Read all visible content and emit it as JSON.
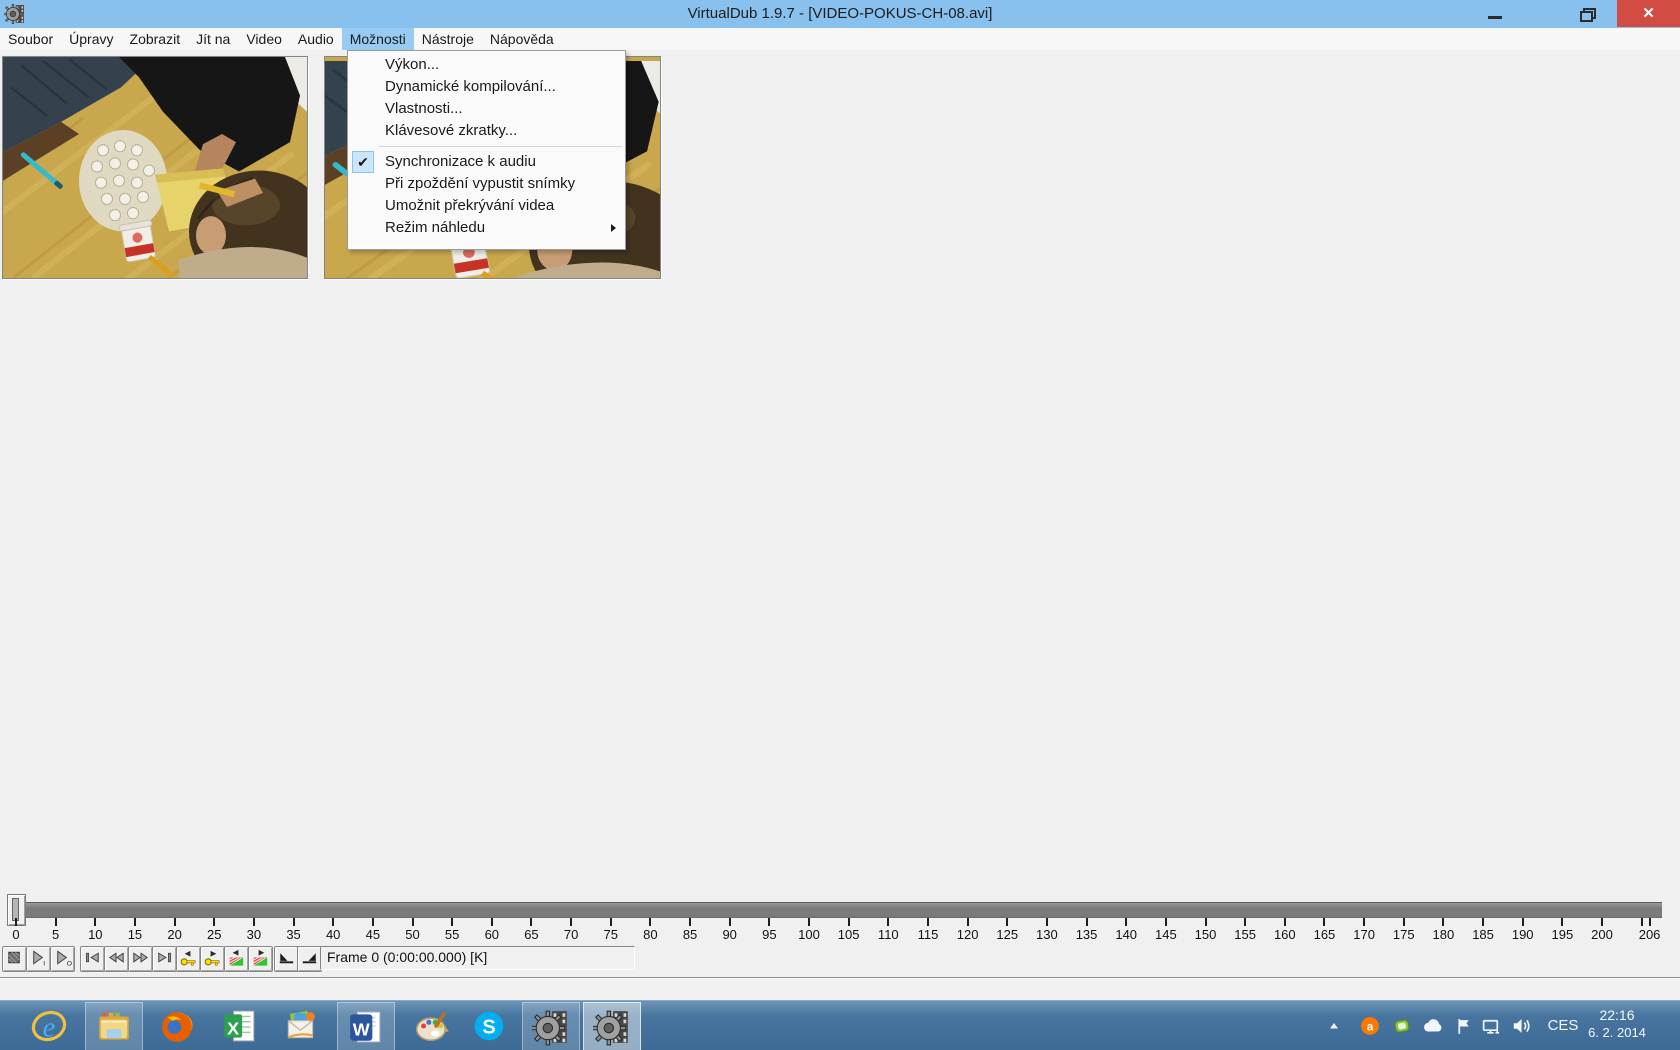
{
  "window": {
    "title": "VirtualDub 1.9.7 - [VIDEO-POKUS-CH-08.avi]"
  },
  "menubar": {
    "items": [
      "Soubor",
      "Úpravy",
      "Zobrazit",
      "Jít na",
      "Video",
      "Audio",
      "Možnosti",
      "Nástroje",
      "Nápověda"
    ],
    "active_index": 6
  },
  "options_menu": {
    "items": [
      {
        "type": "item",
        "label": "Výkon..."
      },
      {
        "type": "item",
        "label": "Dynamické kompilování..."
      },
      {
        "type": "item",
        "label": "Vlastnosti..."
      },
      {
        "type": "item",
        "label": "Klávesové zkratky..."
      },
      {
        "type": "separator"
      },
      {
        "type": "item",
        "label": "Synchronizace k audiu",
        "checked": true
      },
      {
        "type": "item",
        "label": "Při zpoždění vypustit snímky"
      },
      {
        "type": "item",
        "label": "Umožnit překrývání videa"
      },
      {
        "type": "item",
        "label": "Režim náhledu",
        "submenu": true
      }
    ]
  },
  "timeline": {
    "min": 0,
    "max": 206,
    "current_frame": 0,
    "labels": [
      0,
      5,
      10,
      15,
      20,
      25,
      30,
      35,
      40,
      45,
      50,
      55,
      60,
      65,
      70,
      75,
      80,
      85,
      90,
      95,
      100,
      105,
      110,
      115,
      120,
      125,
      130,
      135,
      140,
      145,
      150,
      155,
      160,
      165,
      170,
      175,
      180,
      185,
      190,
      195,
      200,
      206
    ],
    "extra_ticks": [
      205
    ]
  },
  "transport": {
    "buttons": [
      {
        "name": "stop"
      },
      {
        "name": "play-input"
      },
      {
        "name": "play-preview"
      },
      {
        "name": "go-first-frame"
      },
      {
        "name": "rewind"
      },
      {
        "name": "fast-forward"
      },
      {
        "name": "go-last-frame"
      },
      {
        "name": "prev-keyframe"
      },
      {
        "name": "next-keyframe"
      },
      {
        "name": "prev-scene"
      },
      {
        "name": "next-scene"
      },
      {
        "name": "mark-in"
      },
      {
        "name": "mark-out"
      }
    ]
  },
  "statusbar": {
    "frame_text": "Frame 0 (0:00:00.000) [K]"
  },
  "taskbar": {
    "apps": [
      {
        "name": "internet-explorer",
        "open": false,
        "active": false
      },
      {
        "name": "file-explorer",
        "open": true,
        "active": false
      },
      {
        "name": "firefox",
        "open": false,
        "active": false
      },
      {
        "name": "excel",
        "open": false,
        "active": false
      },
      {
        "name": "mail",
        "open": false,
        "active": false
      },
      {
        "name": "word",
        "open": true,
        "active": false
      },
      {
        "name": "paint",
        "open": false,
        "active": false
      },
      {
        "name": "skype",
        "open": false,
        "active": false
      },
      {
        "name": "virtualdub",
        "open": true,
        "active": false
      },
      {
        "name": "virtualdub",
        "open": true,
        "active": true
      }
    ],
    "tray": {
      "icons": [
        "show-hidden-icons",
        "avast",
        "pointing-device",
        "skydrive",
        "action-center",
        "network",
        "volume"
      ],
      "language": "CES",
      "time": "22:16",
      "date": "6. 2. 2014"
    }
  },
  "colors": {
    "titlebar": "#89c1ee",
    "close_button": "#d24c44",
    "menu_highlight": "#98cbf3",
    "taskbar_blue": "#47759f"
  }
}
